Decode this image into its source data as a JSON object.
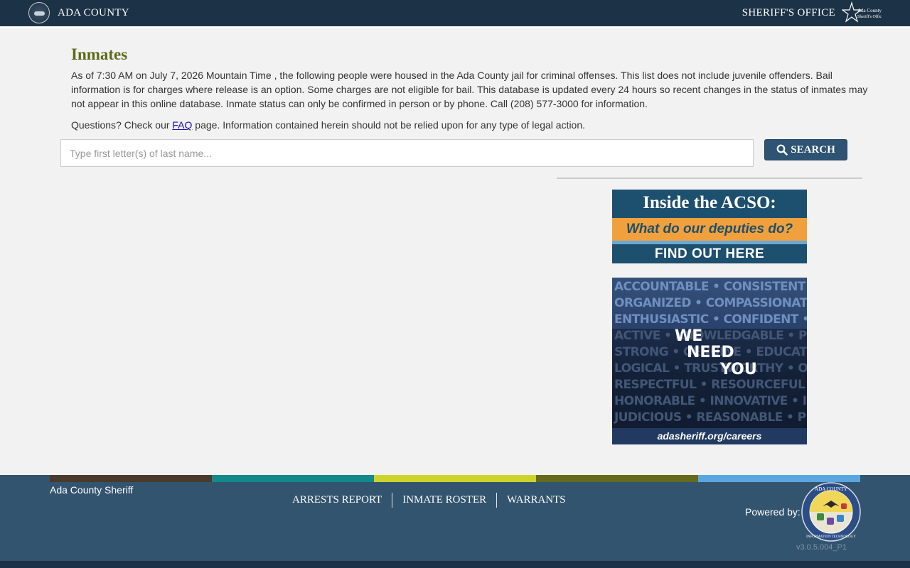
{
  "header": {
    "brand": "ADA COUNTY",
    "office": "SHERIFF'S OFFICE",
    "logo_text": "Ada County Sheriff's Office",
    "colors": {
      "bar": "#1c3246"
    }
  },
  "main": {
    "title": "Inmates",
    "intro": "As of 7:30 AM on July 7, 2026 Mountain Time , the following people were housed in the Ada County jail for criminal offenses. This list does not include juvenile offenders. Bail information is for charges where release is an option. Some charges are not eligible for bail. This database is updated every 24 hours so recent changes in the status of inmates may not appear in this online database. Inmate status can only be confirmed in person or by phone. Call (208) 577-3000 for information.",
    "questions_before": "Questions? Check our ",
    "faq_link": "FAQ",
    "questions_after": " page. Information contained herein should not be relied upon for any type of legal action.",
    "colors": {
      "title": "#5b6b1a"
    }
  },
  "search": {
    "placeholder": "Type first letter(s) of last name...",
    "value": "",
    "button_label": "SEARCH",
    "button_icon": "search-icon"
  },
  "banners": {
    "acso": {
      "heading": "Inside the ACSO:",
      "question": "What do our deputies do?",
      "cta": "FIND OUT HERE"
    },
    "careers": {
      "words": [
        "ACCOUNTABLE • CONSISTENT • ADAPTABLE",
        "ORGANIZED • COMPASSIONATE • ENERGETIC",
        "ENTHUSIASTIC • CONFIDENT • PREPARED",
        "ACTIVE • KNOWLEDGABLE • PROTECTIVE",
        "STRONG • GENUINE • EDUCATOR • HONEST",
        "LOGICAL • TRUSTWORTHY • OUTSTANDING",
        "RESPECTFUL • RESOURCEFUL • RESILIENT",
        "HONORABLE • INNOVATIVE • INQUISITIVE",
        "JUDICIOUS • REASONABLE • PROFESSIONAL"
      ],
      "we": "WE",
      "need": "NEED",
      "you": "YOU",
      "url": "adasheriff.org/careers"
    }
  },
  "footer": {
    "name": "Ada County Sheriff",
    "nav": [
      "ARRESTS REPORT",
      "INMATE ROSTER",
      "WARRANTS"
    ],
    "powered_by": "Powered by:",
    "seal_text": "ADA COUNTY INFORMATION TECHNOLOGY",
    "version": "v3.0.5.004_P1",
    "colors": {
      "bg": "#33546f",
      "stripes": [
        "#4a3a2c",
        "#13898a",
        "#cdd32a",
        "#656a1c",
        "#5aa6e0"
      ]
    }
  }
}
